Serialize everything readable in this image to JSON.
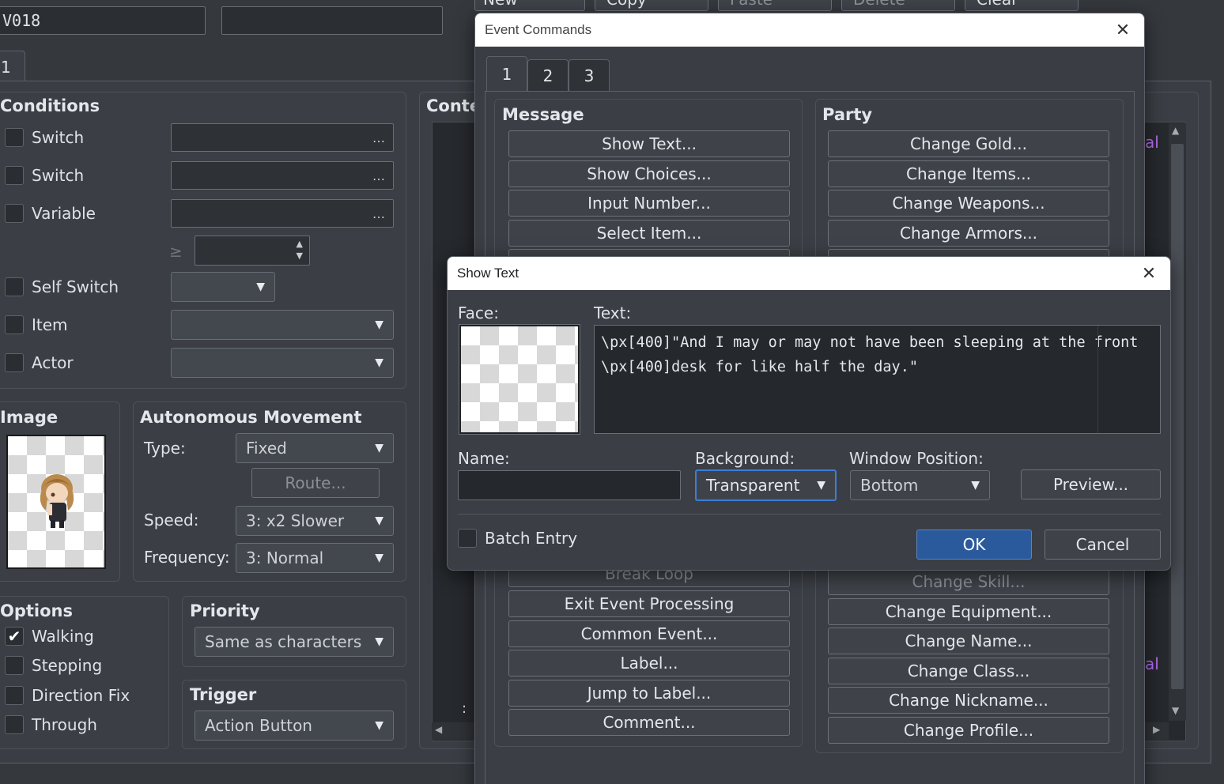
{
  "editor": {
    "id_field": "V018",
    "page_tab": "1",
    "conditions": {
      "title": "Conditions",
      "switch1": "Switch",
      "switch2": "Switch",
      "variable": "Variable",
      "ge_symbol": "≥",
      "self_switch": "Self Switch",
      "item": "Item",
      "actor": "Actor",
      "ellipsis": "…"
    },
    "image_title": "Image",
    "auto_move": {
      "title": "Autonomous Movement",
      "type_label": "Type:",
      "type_value": "Fixed",
      "route_button": "Route...",
      "speed_label": "Speed:",
      "speed_value": "3: x2 Slower",
      "freq_label": "Frequency:",
      "freq_value": "3: Normal"
    },
    "options": {
      "title": "Options",
      "walking": "Walking",
      "stepping": "Stepping",
      "direction_fix": "Direction Fix",
      "through": "Through"
    },
    "priority": {
      "title": "Priority",
      "value": "Same as characters"
    },
    "trigger": {
      "title": "Trigger",
      "value": "Action Button"
    },
    "contents_title": "Conte",
    "top_buttons": [
      "New",
      "Copy",
      "Paste",
      "Delete",
      "Clear"
    ],
    "bg_partial_text": "al",
    "bg_colon": ":"
  },
  "event_commands": {
    "title": "Event Commands",
    "tabs": [
      "1",
      "2",
      "3"
    ],
    "message_group": "Message",
    "party_group": "Party",
    "message_buttons": [
      "Show Text...",
      "Show Choices...",
      "Input Number...",
      "Select Item..."
    ],
    "flow_buttons": [
      "Break Loop",
      "Exit Event Processing",
      "Common Event...",
      "Label...",
      "Jump to Label...",
      "Comment..."
    ],
    "party_buttons": [
      "Change Gold...",
      "Change Items...",
      "Change Weapons...",
      "Change Armors..."
    ],
    "actor_buttons": [
      "Change Skill...",
      "Change Equipment...",
      "Change Name...",
      "Change Class...",
      "Change Nickname...",
      "Change Profile..."
    ]
  },
  "show_text": {
    "title": "Show Text",
    "face_label": "Face:",
    "text_label": "Text:",
    "text_lines": [
      "\\px[400]\"And I may or may not have been sleeping at the front",
      "\\px[400]desk for like half the day.\""
    ],
    "name_label": "Name:",
    "name_value": "",
    "background_label": "Background:",
    "background_value": "Transparent",
    "window_position_label": "Window Position:",
    "window_position_value": "Bottom",
    "preview_button": "Preview...",
    "batch_entry": "Batch Entry",
    "ok": "OK",
    "cancel": "Cancel"
  },
  "colors": {
    "accent_blue": "#2b5a9c",
    "checkbox_check": "#ffffff",
    "partial_purple": "#b56cf0"
  },
  "icons": {
    "close": "close-icon",
    "dropdown": "chevron-down-icon",
    "check": "checkmark-icon",
    "ellipsis": "ellipsis-icon",
    "spin": "spin-arrows-icon",
    "scroll_up": "scroll-up-icon",
    "scroll_down": "scroll-down-icon",
    "scroll_left": "scroll-left-icon",
    "scroll_right": "scroll-right-icon"
  }
}
